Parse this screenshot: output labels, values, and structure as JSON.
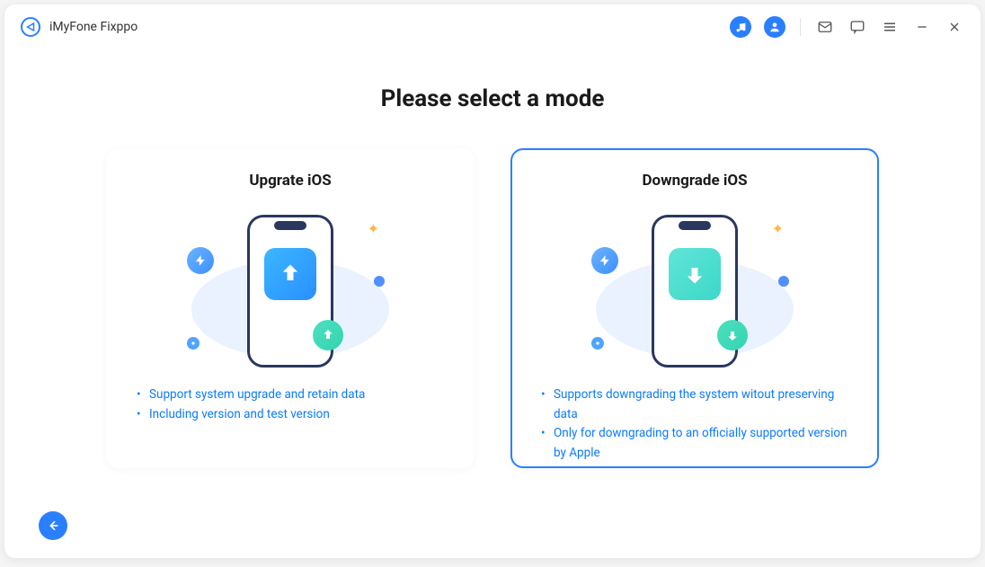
{
  "app": {
    "name": "iMyFone Fixppo"
  },
  "main": {
    "title": "Please select a mode",
    "cards": [
      {
        "title": "Upgrate iOS",
        "selected": false,
        "bullets": [
          "Support system upgrade and retain data",
          "Including version and test version"
        ]
      },
      {
        "title": "Downgrade iOS",
        "selected": true,
        "bullets": [
          "Supports downgrading the system witout preserving data",
          "Only for downgrading to an officially supported version by Apple"
        ]
      }
    ]
  }
}
